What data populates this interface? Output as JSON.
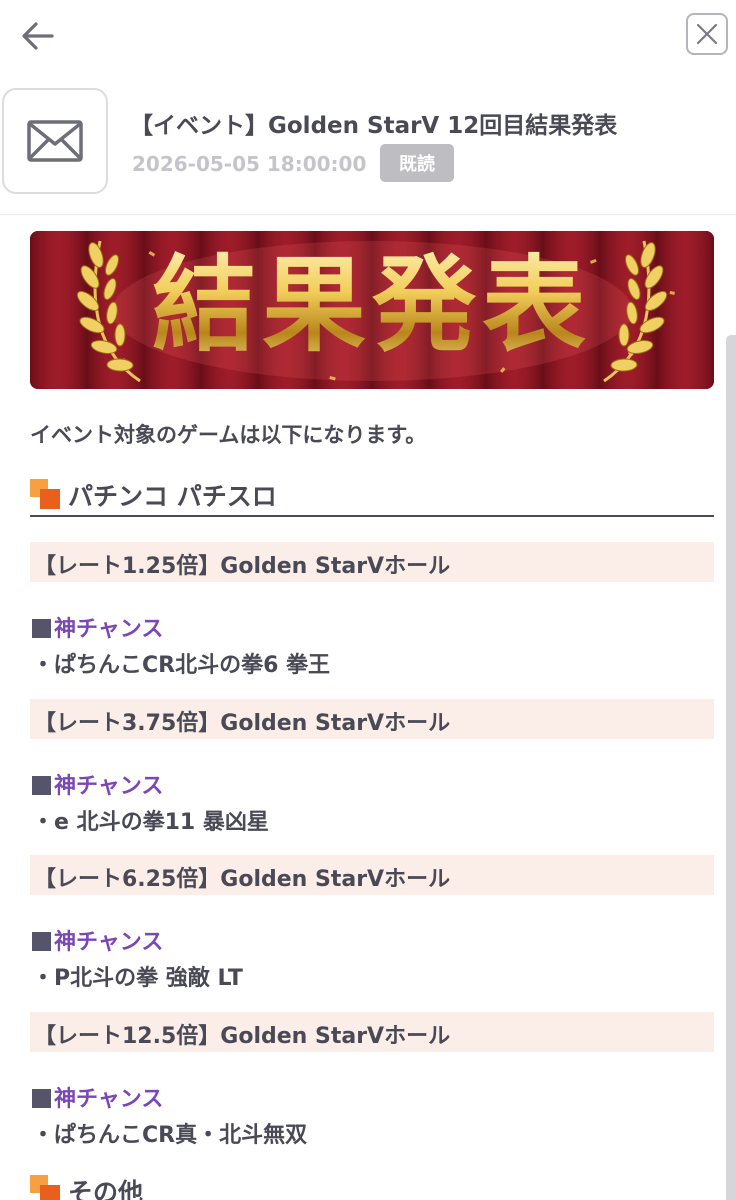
{
  "nav": {
    "back_icon": "arrow-left-icon",
    "close_icon": "close-icon"
  },
  "message": {
    "icon": "envelope-icon",
    "title": "【イベント】Golden StarV 12回目結果発表",
    "date": "2026-05-05 18:00:00",
    "badge": "既読"
  },
  "banner": {
    "text": "結果発表"
  },
  "intro": "イベント対象のゲームは以下になります。",
  "sections": [
    {
      "title": "パチンコ パチスロ"
    },
    {
      "title": "その他"
    }
  ],
  "rates": [
    {
      "label": "【レート1.25倍】Golden StarVホール",
      "chance": "神チャンス",
      "game": "・ぱちんこCR北斗の拳6 拳王"
    },
    {
      "label": "【レート3.75倍】Golden StarVホール",
      "chance": "神チャンス",
      "game": "・e 北斗の拳11 暴凶星"
    },
    {
      "label": "【レート6.25倍】Golden StarVホール",
      "chance": "神チャンス",
      "game": "・P北斗の拳 強敵 LT"
    },
    {
      "label": "【レート12.5倍】Golden StarVホール",
      "chance": "神チャンス",
      "game": "・ぱちんこCR真・北斗無双"
    }
  ],
  "colors": {
    "text": "#4a4a56",
    "link": "#7a46b8",
    "rate_bg": "#fbeee9",
    "badge_bg": "#bdbdc2",
    "accent_orange": "#f08a1c"
  }
}
